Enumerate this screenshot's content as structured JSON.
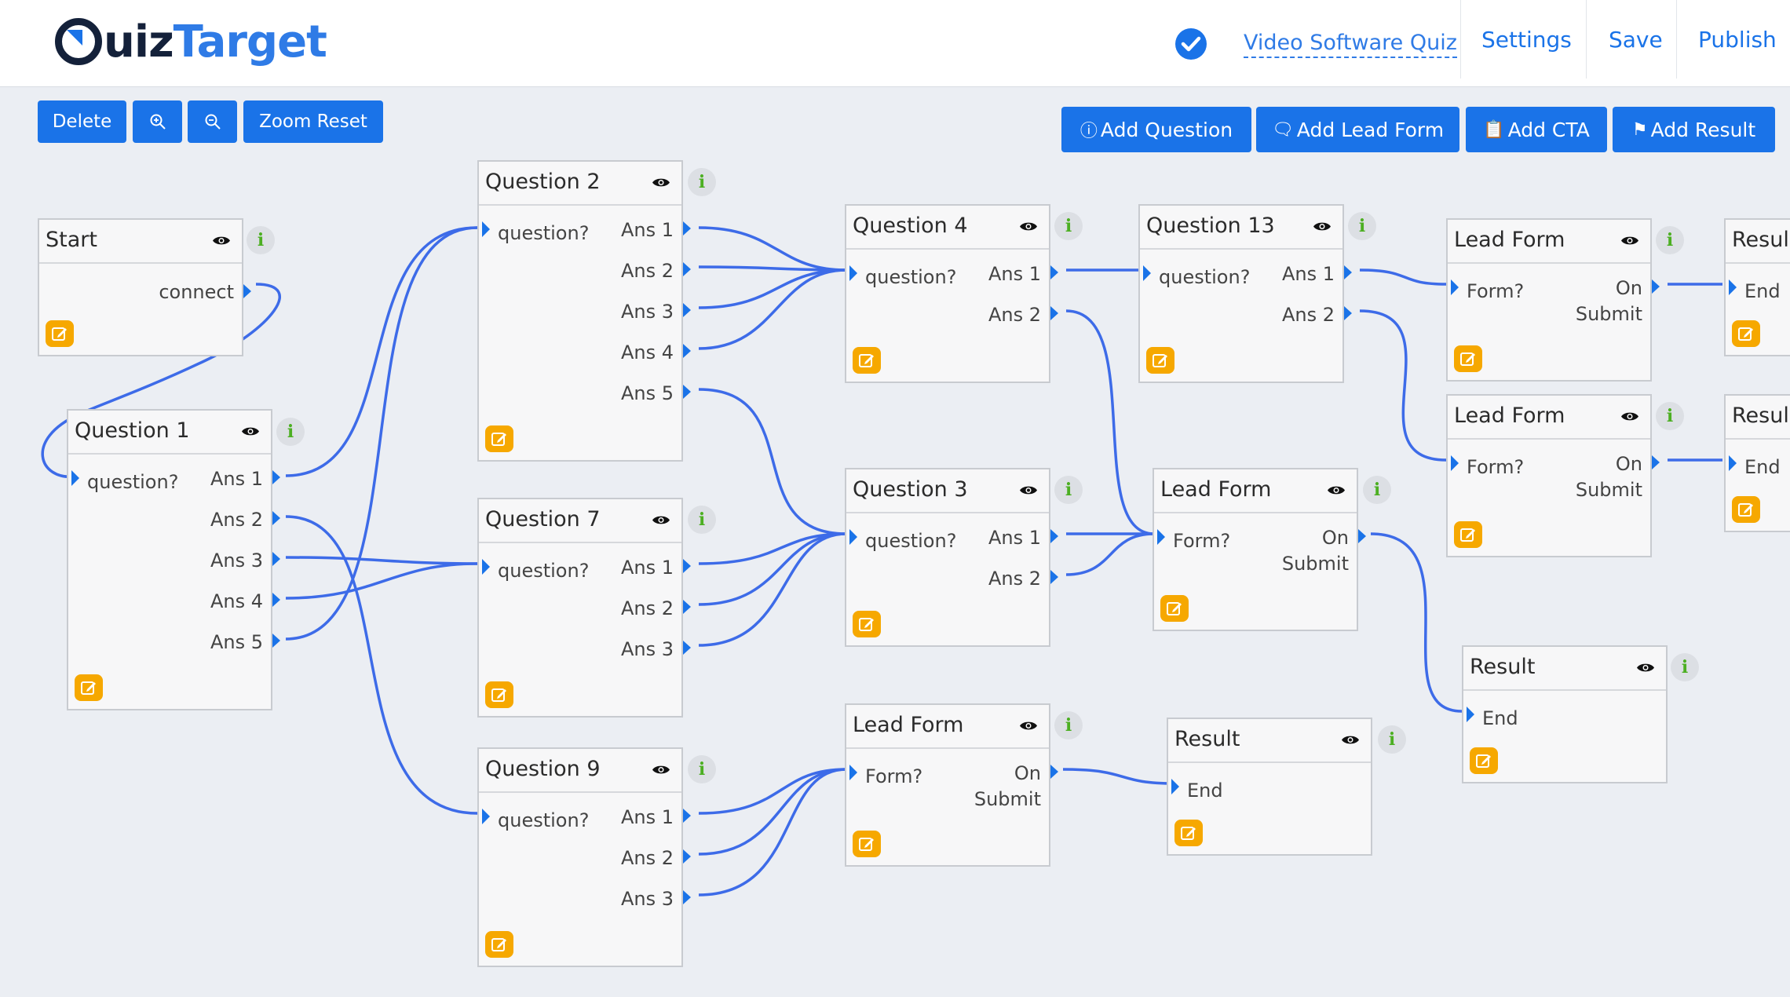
{
  "header": {
    "logo": {
      "q": "Q",
      "mid": "uiz",
      "end": "Target"
    },
    "quiz_name": "Video Software Quiz",
    "nav": {
      "settings": "Settings",
      "save": "Save",
      "publish": "Publish"
    }
  },
  "toolbar": {
    "delete": "Delete",
    "zoom_in_icon": "zoom-in-icon",
    "zoom_out_icon": "zoom-out-icon",
    "zoom_reset": "Zoom Reset",
    "add_question": "Add Question",
    "add_lead_form": "Add Lead Form",
    "add_cta": "Add CTA",
    "add_result": "Add Result"
  },
  "nodes": {
    "start": {
      "title": "Start",
      "connect": "connect"
    },
    "q1": {
      "title": "Question 1",
      "question": "question?",
      "answers": [
        "Ans 1",
        "Ans 2",
        "Ans 3",
        "Ans 4",
        "Ans 5"
      ]
    },
    "q2": {
      "title": "Question 2",
      "question": "question?",
      "answers": [
        "Ans 1",
        "Ans 2",
        "Ans 3",
        "Ans 4",
        "Ans 5"
      ]
    },
    "q7": {
      "title": "Question 7",
      "question": "question?",
      "answers": [
        "Ans 1",
        "Ans 2",
        "Ans 3"
      ]
    },
    "q9": {
      "title": "Question 9",
      "question": "question?",
      "answers": [
        "Ans 1",
        "Ans 2",
        "Ans 3"
      ]
    },
    "q4": {
      "title": "Question 4",
      "question": "question?",
      "answers": [
        "Ans 1",
        "Ans 2"
      ]
    },
    "q3": {
      "title": "Question 3",
      "question": "question?",
      "answers": [
        "Ans 1",
        "Ans 2"
      ]
    },
    "q13": {
      "title": "Question 13",
      "question": "question?",
      "answers": [
        "Ans 1",
        "Ans 2"
      ]
    },
    "lf_mid": {
      "title": "Lead Form",
      "form": "Form?",
      "submit_1": "On",
      "submit_2": "Submit"
    },
    "lf_bottom": {
      "title": "Lead Form",
      "form": "Form?",
      "submit_1": "On",
      "submit_2": "Submit"
    },
    "lf_top1": {
      "title": "Lead Form",
      "form": "Form?",
      "submit_1": "On",
      "submit_2": "Submit"
    },
    "lf_top2": {
      "title": "Lead Form",
      "form": "Form?",
      "submit_1": "On",
      "submit_2": "Submit"
    },
    "result_bottom": {
      "title": "Result",
      "end": "End"
    },
    "result_right": {
      "title": "Result",
      "end": "End"
    },
    "result_edge1": {
      "title": "Resul",
      "end": "End"
    },
    "result_edge2": {
      "title": "Resul",
      "end": "End"
    }
  },
  "colors": {
    "accent": "#1a73e8",
    "edit": "#f6a800",
    "info": "#4caf22",
    "canvas": "#ebeef3"
  },
  "icons": {
    "eye": "eye-icon",
    "info": "info-icon",
    "edit": "edit-icon",
    "check": "check-circle-icon"
  }
}
